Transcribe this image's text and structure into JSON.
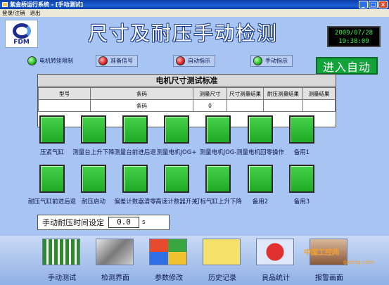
{
  "window": {
    "title": "紫金桥运行系统 - [手动测试]"
  },
  "menu": [
    "登录/注销",
    "退出"
  ],
  "header": {
    "logo_text": "FDM",
    "title": "尺寸及耐压手动检测",
    "date": "2009/07/28",
    "time": "19:38:09"
  },
  "indicators": [
    {
      "label": "电机转矩限制",
      "color": "green"
    },
    {
      "label": "准备信号",
      "color": "red"
    },
    {
      "label": "自动指示",
      "color": "red"
    },
    {
      "label": "手动指示",
      "color": "green"
    }
  ],
  "auto_button": "进入自动",
  "table": {
    "title": "电机尺寸测试标准",
    "headers": [
      "型号",
      "条码",
      "测量尺寸",
      "尺寸测量结果",
      "耐压测量结果",
      "测量结果"
    ],
    "row": [
      "",
      "条码",
      "0",
      "",
      "",
      ""
    ]
  },
  "row1_labels": [
    "压紧气缸",
    "测量台上升下降",
    "测量台前进后退",
    "测量电机JOG+",
    "测量电机JOG-",
    "测量电机回零操作",
    "备用1"
  ],
  "row2_labels": [
    "耐压气缸前进后退",
    "耐压启动",
    "偏差计数器清零",
    "高速计数器开关",
    "打标气缸上升下降",
    "备用2",
    "备用3"
  ],
  "time_setting": {
    "label": "手动耐压时间设定",
    "value": "0.0",
    "unit": "s"
  },
  "nav": [
    {
      "label": "手动测试",
      "icon": "panel-icon"
    },
    {
      "label": "检测界面",
      "icon": "machine-icon"
    },
    {
      "label": "参数修改",
      "icon": "windows-icon"
    },
    {
      "label": "历史记录",
      "icon": "search-icon"
    },
    {
      "label": "良品统计",
      "icon": "pie-chart-icon"
    },
    {
      "label": "报警画面",
      "icon": "alarm-icon"
    }
  ],
  "watermark": {
    "line1": "中国工控网",
    "line2": "gkong.com"
  },
  "colors": {
    "button_green": "#2fbf34",
    "panel_bg": "#a8c4f2",
    "clock_text": "#38f04a",
    "auto_green": "#12a43a"
  }
}
